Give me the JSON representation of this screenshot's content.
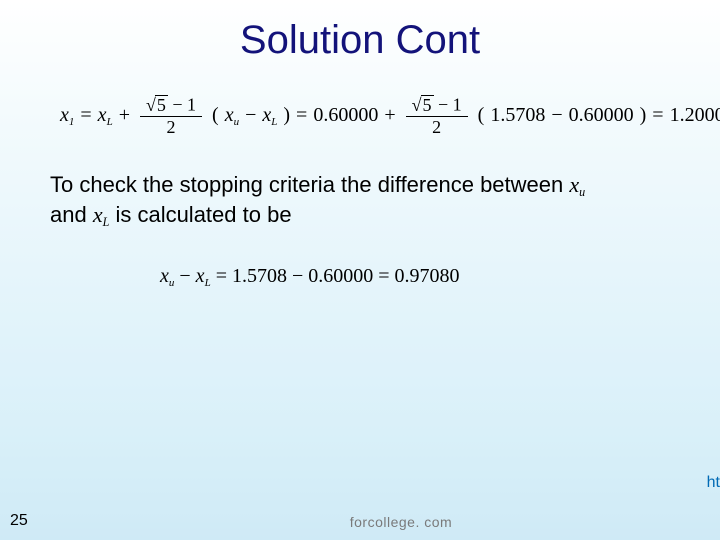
{
  "title": "Solution Cont",
  "eq1": {
    "lhs_var": "x",
    "lhs_sub": "1",
    "equals": " = ",
    "xL_var": "x",
    "xL_sub": "L",
    "plus": " + ",
    "frac_num_rad": "5",
    "frac_num_rest": " − 1",
    "frac_den": "2",
    "open": "(",
    "xu_var": "x",
    "xu_sub": "u",
    "minus": " − ",
    "close": ")",
    "eq2_sym": " = ",
    "v_xL": "0.60000",
    "plus2": " + ",
    "open2": "(",
    "v_xu": "1.5708",
    "minus2": " − ",
    "v_xL2": "0.60000",
    "close2": ")",
    "eq3_sym": " = ",
    "result": "1.2000"
  },
  "body": {
    "t1": "To check the stopping criteria the difference between ",
    "xu_var": "x",
    "xu_sub": "u",
    "t2": " and ",
    "xL_var": "x",
    "xL_sub": "L",
    "t3": " is calculated to be"
  },
  "eq2": {
    "xu_var": "x",
    "xu_sub": "u",
    "minus": " − ",
    "xL_var": "x",
    "xL_sub": "L",
    "equals": " = ",
    "v1": "1.5708",
    "minus2": " − ",
    "v2": "0.60000",
    "eq2_sym": " = ",
    "result": "0.97080"
  },
  "pagenum": "25",
  "footer": "forcollege. com",
  "edge": "ht"
}
